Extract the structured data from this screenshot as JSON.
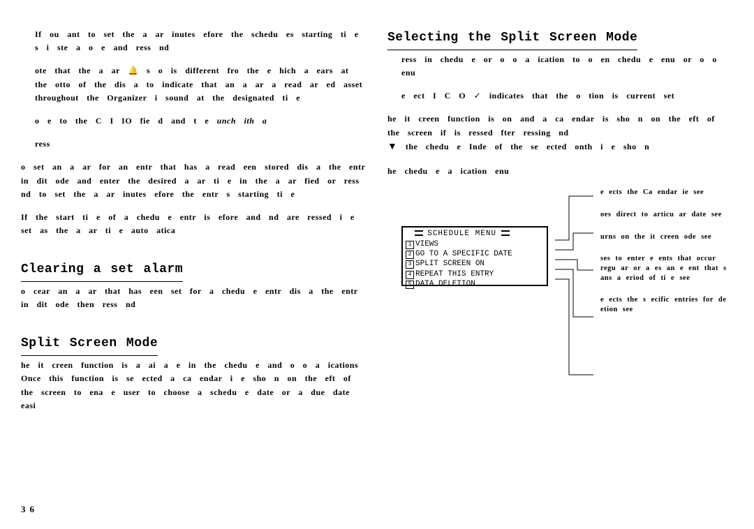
{
  "pageNumber": "36",
  "leftColumn": {
    "p1": "If ou ant to set the a ar  inutes efore the schedu es starting ti e s i ste a o e and ress nd",
    "p2_a": "ote that the a ar ",
    "p2_bell": "🔔",
    "p2_b": " s o is different fro the e hich a ears at the otto of the dis a to indicate that an a ar a read ar ed asset throughout the Organizer i sound at the designated ti e",
    "p3_a": "o e to the  C I IO fie d  and t e ",
    "p3_italic": "unch ith a",
    "p4": "ress",
    "p5": "o set an a ar for an entr that has a read een stored dis a the entr in dit ode and enter the desired a ar ti e in the a ar fied or ress nd to set the a ar inutes efore the entr s starting ti e",
    "p6": "If the start ti e of a chedu e entr is efore and nd  are ressed  i e set as the a ar ti e auto atica",
    "h2a": "Clearing a set alarm",
    "p7": "o cear an a ar that has een set for a chedu e entr dis a the entr in dit ode then ress nd",
    "h2b": "Split Screen Mode",
    "p8": "he it creen function is a ai a e in the chedu e and o o a ications Once this function is se ected a ca endar i e sho n on the eft of the screen to ena e user to choose a schedu e date or a due date easi"
  },
  "rightColumn": {
    "h2c": "Selecting the Split Screen Mode",
    "p1": "ress  in chedu e or o o a ication to o en chedu e enu or o o enu",
    "p2_a": "e ect   I  C  O  ",
    "p2_check": "✓",
    "p2_b": " indicates  that the o tion is current  set",
    "p3_a": "he it creen function is on and a ca endar is sho n on the eft of the screen if  is ressed fter ressing nd ",
    "p3_arrow": "▼",
    "p3_b": " the chedu e Inde of the se ected onth i e sho n",
    "p4": "he chedu e a ication enu",
    "menu": {
      "title": "SCHEDULE MENU",
      "items": [
        {
          "n": "1",
          "label": "VIEWS"
        },
        {
          "n": "2",
          "label": "GO TO A SPECIFIC DATE"
        },
        {
          "n": "3",
          "label": "SPLIT SCREEN ON"
        },
        {
          "n": "4",
          "label": "REPEAT THIS ENTRY"
        },
        {
          "n": "5",
          "label": "DATA DELETION"
        }
      ]
    },
    "annotations": [
      "e ects the Ca endar ie see",
      "oes direct to articu ar date see",
      "urns on the it creen ode see",
      "ses to enter e ents that occur regu ar or a es an e ent that s ans a eriod of ti e see",
      "e ects the s ecific entries for de etion see"
    ]
  }
}
